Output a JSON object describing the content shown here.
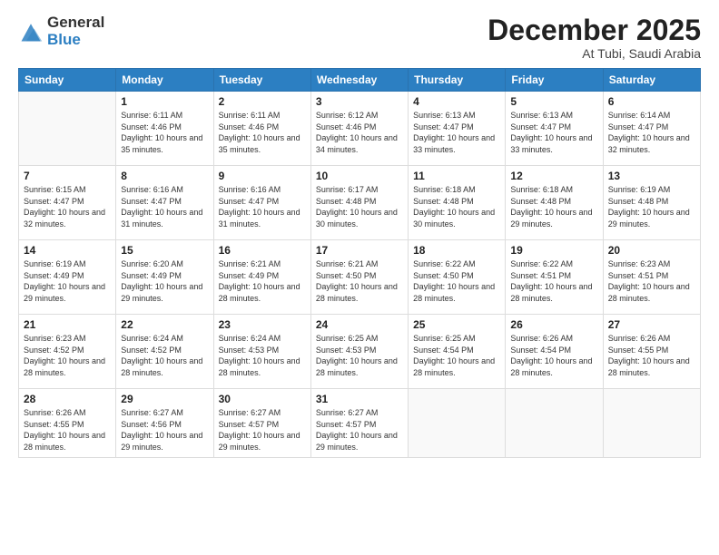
{
  "logo": {
    "general": "General",
    "blue": "Blue"
  },
  "header": {
    "title": "December 2025",
    "subtitle": "At Tubi, Saudi Arabia"
  },
  "weekdays": [
    "Sunday",
    "Monday",
    "Tuesday",
    "Wednesday",
    "Thursday",
    "Friday",
    "Saturday"
  ],
  "weeks": [
    [
      {
        "day": "",
        "sunrise": "",
        "sunset": "",
        "daylight": ""
      },
      {
        "day": "1",
        "sunrise": "Sunrise: 6:11 AM",
        "sunset": "Sunset: 4:46 PM",
        "daylight": "Daylight: 10 hours and 35 minutes."
      },
      {
        "day": "2",
        "sunrise": "Sunrise: 6:11 AM",
        "sunset": "Sunset: 4:46 PM",
        "daylight": "Daylight: 10 hours and 35 minutes."
      },
      {
        "day": "3",
        "sunrise": "Sunrise: 6:12 AM",
        "sunset": "Sunset: 4:46 PM",
        "daylight": "Daylight: 10 hours and 34 minutes."
      },
      {
        "day": "4",
        "sunrise": "Sunrise: 6:13 AM",
        "sunset": "Sunset: 4:47 PM",
        "daylight": "Daylight: 10 hours and 33 minutes."
      },
      {
        "day": "5",
        "sunrise": "Sunrise: 6:13 AM",
        "sunset": "Sunset: 4:47 PM",
        "daylight": "Daylight: 10 hours and 33 minutes."
      },
      {
        "day": "6",
        "sunrise": "Sunrise: 6:14 AM",
        "sunset": "Sunset: 4:47 PM",
        "daylight": "Daylight: 10 hours and 32 minutes."
      }
    ],
    [
      {
        "day": "7",
        "sunrise": "Sunrise: 6:15 AM",
        "sunset": "Sunset: 4:47 PM",
        "daylight": "Daylight: 10 hours and 32 minutes."
      },
      {
        "day": "8",
        "sunrise": "Sunrise: 6:16 AM",
        "sunset": "Sunset: 4:47 PM",
        "daylight": "Daylight: 10 hours and 31 minutes."
      },
      {
        "day": "9",
        "sunrise": "Sunrise: 6:16 AM",
        "sunset": "Sunset: 4:47 PM",
        "daylight": "Daylight: 10 hours and 31 minutes."
      },
      {
        "day": "10",
        "sunrise": "Sunrise: 6:17 AM",
        "sunset": "Sunset: 4:48 PM",
        "daylight": "Daylight: 10 hours and 30 minutes."
      },
      {
        "day": "11",
        "sunrise": "Sunrise: 6:18 AM",
        "sunset": "Sunset: 4:48 PM",
        "daylight": "Daylight: 10 hours and 30 minutes."
      },
      {
        "day": "12",
        "sunrise": "Sunrise: 6:18 AM",
        "sunset": "Sunset: 4:48 PM",
        "daylight": "Daylight: 10 hours and 29 minutes."
      },
      {
        "day": "13",
        "sunrise": "Sunrise: 6:19 AM",
        "sunset": "Sunset: 4:48 PM",
        "daylight": "Daylight: 10 hours and 29 minutes."
      }
    ],
    [
      {
        "day": "14",
        "sunrise": "Sunrise: 6:19 AM",
        "sunset": "Sunset: 4:49 PM",
        "daylight": "Daylight: 10 hours and 29 minutes."
      },
      {
        "day": "15",
        "sunrise": "Sunrise: 6:20 AM",
        "sunset": "Sunset: 4:49 PM",
        "daylight": "Daylight: 10 hours and 29 minutes."
      },
      {
        "day": "16",
        "sunrise": "Sunrise: 6:21 AM",
        "sunset": "Sunset: 4:49 PM",
        "daylight": "Daylight: 10 hours and 28 minutes."
      },
      {
        "day": "17",
        "sunrise": "Sunrise: 6:21 AM",
        "sunset": "Sunset: 4:50 PM",
        "daylight": "Daylight: 10 hours and 28 minutes."
      },
      {
        "day": "18",
        "sunrise": "Sunrise: 6:22 AM",
        "sunset": "Sunset: 4:50 PM",
        "daylight": "Daylight: 10 hours and 28 minutes."
      },
      {
        "day": "19",
        "sunrise": "Sunrise: 6:22 AM",
        "sunset": "Sunset: 4:51 PM",
        "daylight": "Daylight: 10 hours and 28 minutes."
      },
      {
        "day": "20",
        "sunrise": "Sunrise: 6:23 AM",
        "sunset": "Sunset: 4:51 PM",
        "daylight": "Daylight: 10 hours and 28 minutes."
      }
    ],
    [
      {
        "day": "21",
        "sunrise": "Sunrise: 6:23 AM",
        "sunset": "Sunset: 4:52 PM",
        "daylight": "Daylight: 10 hours and 28 minutes."
      },
      {
        "day": "22",
        "sunrise": "Sunrise: 6:24 AM",
        "sunset": "Sunset: 4:52 PM",
        "daylight": "Daylight: 10 hours and 28 minutes."
      },
      {
        "day": "23",
        "sunrise": "Sunrise: 6:24 AM",
        "sunset": "Sunset: 4:53 PM",
        "daylight": "Daylight: 10 hours and 28 minutes."
      },
      {
        "day": "24",
        "sunrise": "Sunrise: 6:25 AM",
        "sunset": "Sunset: 4:53 PM",
        "daylight": "Daylight: 10 hours and 28 minutes."
      },
      {
        "day": "25",
        "sunrise": "Sunrise: 6:25 AM",
        "sunset": "Sunset: 4:54 PM",
        "daylight": "Daylight: 10 hours and 28 minutes."
      },
      {
        "day": "26",
        "sunrise": "Sunrise: 6:26 AM",
        "sunset": "Sunset: 4:54 PM",
        "daylight": "Daylight: 10 hours and 28 minutes."
      },
      {
        "day": "27",
        "sunrise": "Sunrise: 6:26 AM",
        "sunset": "Sunset: 4:55 PM",
        "daylight": "Daylight: 10 hours and 28 minutes."
      }
    ],
    [
      {
        "day": "28",
        "sunrise": "Sunrise: 6:26 AM",
        "sunset": "Sunset: 4:55 PM",
        "daylight": "Daylight: 10 hours and 28 minutes."
      },
      {
        "day": "29",
        "sunrise": "Sunrise: 6:27 AM",
        "sunset": "Sunset: 4:56 PM",
        "daylight": "Daylight: 10 hours and 29 minutes."
      },
      {
        "day": "30",
        "sunrise": "Sunrise: 6:27 AM",
        "sunset": "Sunset: 4:57 PM",
        "daylight": "Daylight: 10 hours and 29 minutes."
      },
      {
        "day": "31",
        "sunrise": "Sunrise: 6:27 AM",
        "sunset": "Sunset: 4:57 PM",
        "daylight": "Daylight: 10 hours and 29 minutes."
      },
      {
        "day": "",
        "sunrise": "",
        "sunset": "",
        "daylight": ""
      },
      {
        "day": "",
        "sunrise": "",
        "sunset": "",
        "daylight": ""
      },
      {
        "day": "",
        "sunrise": "",
        "sunset": "",
        "daylight": ""
      }
    ]
  ]
}
